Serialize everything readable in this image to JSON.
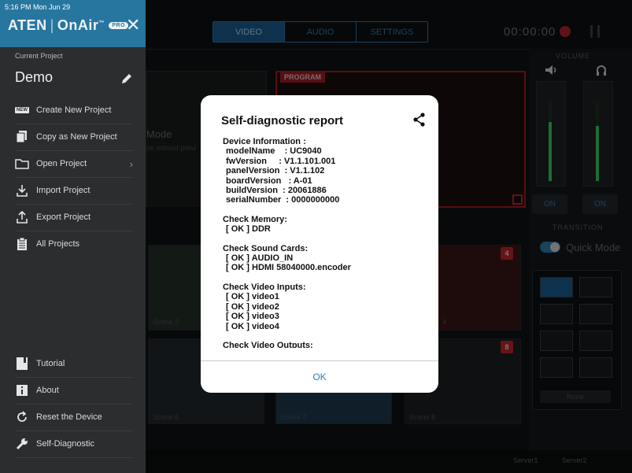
{
  "status_bar": {
    "time": "5:16 PM",
    "date": "Mon Jun 29"
  },
  "brand": {
    "aten": "ATEN",
    "separator": "|",
    "product": "OnAir",
    "tm": "™",
    "badge": "PRO"
  },
  "sidebar": {
    "current_project_label": "Current Project",
    "project_name": "Demo",
    "items": [
      {
        "label": "Create New Project",
        "icon": "new-badge-icon"
      },
      {
        "label": "Copy as New Project",
        "icon": "copy-icon"
      },
      {
        "label": "Open Project",
        "icon": "folder-icon",
        "chevron": "›"
      },
      {
        "label": "Import Project",
        "icon": "import-icon"
      },
      {
        "label": "Export Project",
        "icon": "export-icon"
      },
      {
        "label": "All Projects",
        "icon": "clipboard-icon"
      }
    ],
    "footer_items": [
      {
        "label": "Tutorial",
        "icon": "tutorial-icon"
      },
      {
        "label": "About",
        "icon": "info-icon"
      },
      {
        "label": "Reset the Device",
        "icon": "reset-icon"
      },
      {
        "label": "Self-Diagnostic",
        "icon": "wrench-icon"
      }
    ],
    "new_badge_text": "NEW"
  },
  "topbar": {
    "tabs": [
      "VIDEO",
      "AUDIO",
      "SETTINGS"
    ],
    "active_tab": "VIDEO",
    "timer": "00:00:00"
  },
  "preview": {
    "mode_text": "Mode",
    "sub_text": "ne without previ"
  },
  "program": {
    "label": "PROGRAM"
  },
  "volume": {
    "label": "VOLUME",
    "left_on": "ON",
    "right_on": "ON",
    "left_level": 0.75,
    "right_level": 0.7
  },
  "transition": {
    "label": "TRANSITION",
    "quick_mode": "Quick Mode",
    "none_label": "None"
  },
  "scenes": [
    {
      "label": "Scene 2",
      "number": ""
    },
    {
      "label": "4",
      "number": "4"
    },
    {
      "label": "Scene 6",
      "number": ""
    },
    {
      "label": "Scene 7",
      "number": ""
    },
    {
      "label": "Scene 8",
      "number": "8"
    }
  ],
  "bottom": {
    "server1": "Server1",
    "server2": "Server2"
  },
  "modal": {
    "title": "Self-diagnostic report",
    "device_info_header": "Device Information :",
    "device_info": [
      "modelName    : UC9040",
      "fwVersion     : V1.1.101.001",
      "panelVersion  : V1.1.102",
      "boardVersion   : A-01",
      "buildVersion  : 20061886",
      "serialNumber  : 0000000000"
    ],
    "memory_header": "Check Memory:",
    "memory": [
      "[ OK ] DDR"
    ],
    "sound_header": "Check Sound Cards:",
    "sound": [
      "[ OK ] AUDIO_IN",
      "[ OK ] HDMI 58040000.encoder"
    ],
    "video_in_header": "Check Video Inputs:",
    "video_in": [
      "[ OK ] video1",
      "[ OK ] video2",
      "[ OK ] video3",
      "[ OK ] video4"
    ],
    "video_out_header": "Check Video Outputs:",
    "ok_label": "OK"
  }
}
